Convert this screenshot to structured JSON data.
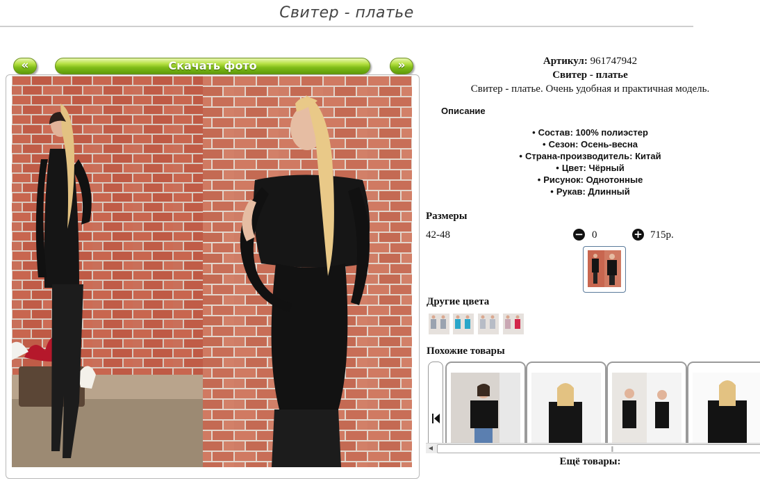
{
  "page": {
    "title": "Свитер - платье"
  },
  "gallery": {
    "prev_label": "«",
    "next_label": "»",
    "download_label": "Скачать фото"
  },
  "product": {
    "sku_label": "Артикул:",
    "sku_value": "961747942",
    "name": "Свитер - платье",
    "short_description": "Свитер - платье. Очень удобная и практичная модель.",
    "description_heading": "Описание",
    "features": [
      "Состав: 100% полиэстер",
      "Сезон: Осень-весна",
      "Страна-производитель: Китай",
      "Цвет: Чёрный",
      "Рисунок: Однотонные",
      "Рукав: Длинный"
    ]
  },
  "sizes": {
    "heading": "Размеры",
    "row": {
      "size": "42-48",
      "minus": "−",
      "quantity": "0",
      "plus": "+",
      "price": "715р."
    }
  },
  "other_colors": {
    "heading": "Другие цвета",
    "swatches": [
      {
        "color": "#9aa3b0"
      },
      {
        "color": "#2aa6c9"
      },
      {
        "color": "#b7bcc6"
      },
      {
        "color": "#c9a7b3"
      },
      {
        "color": "#d2264a"
      }
    ]
  },
  "similar": {
    "heading": "Похожие товары",
    "more_label": "Ещё товары:"
  },
  "colors": {
    "button_green": "#7fbc18",
    "brick": "#c5634f",
    "garment": "#121212",
    "hair": "#e2c280"
  }
}
